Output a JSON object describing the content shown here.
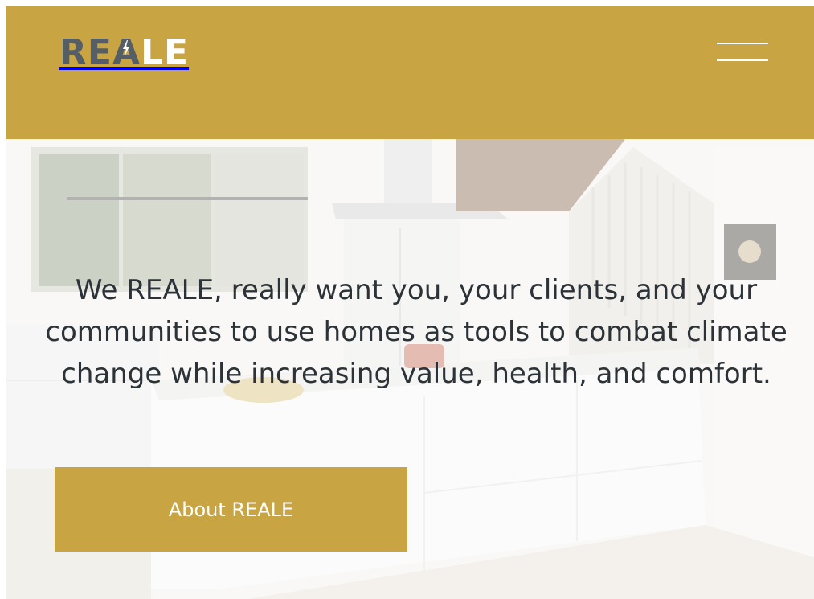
{
  "brand": {
    "logo_dark": "REA",
    "logo_light": "LE",
    "logo_full": "REALE",
    "colors": {
      "accent": "#c8a443",
      "logo_gray": "#545e64",
      "text": "#2c3338"
    }
  },
  "header": {
    "menu_icon": "hamburger-menu-icon"
  },
  "hero": {
    "headline": "We REALE, really want you, your clients, and your communities to use homes as tools to combat climate change while increasing value, health, and comfort.",
    "cta_label": "About REALE",
    "background": "kitchen-photo"
  }
}
